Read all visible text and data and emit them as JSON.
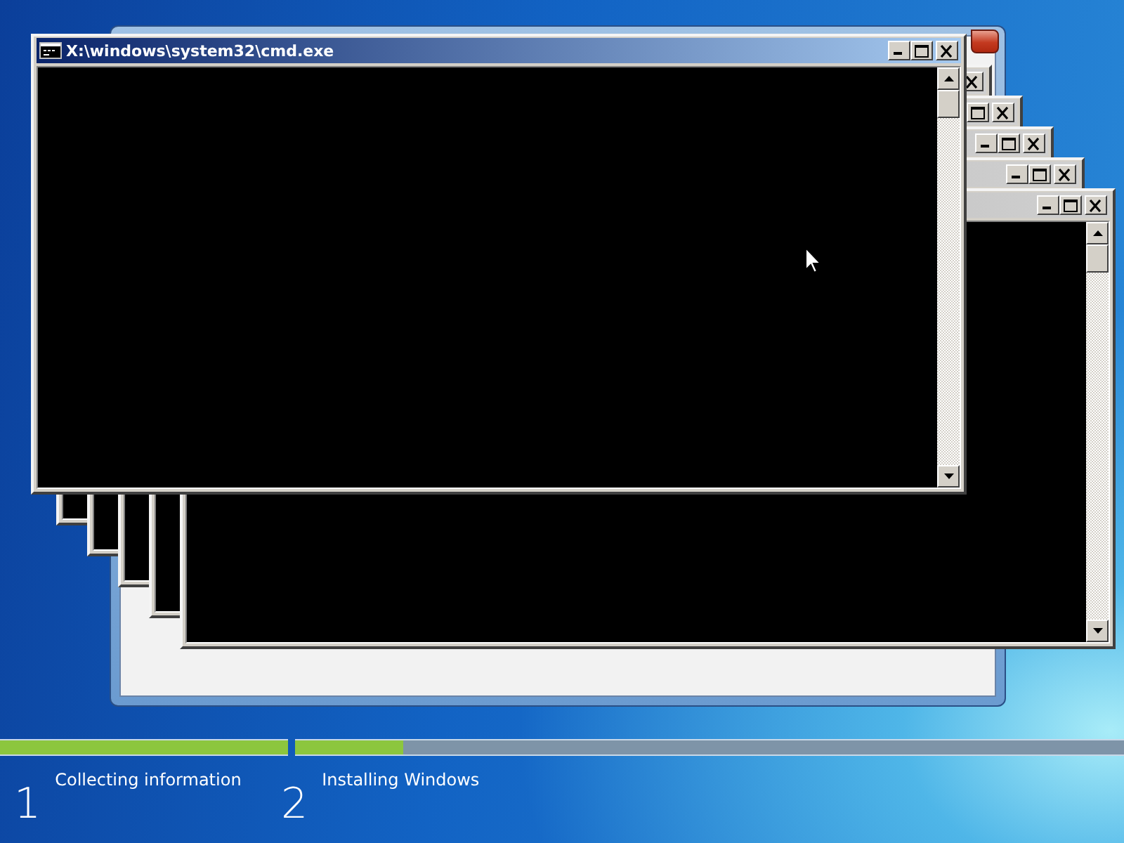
{
  "console_windows": [
    {
      "active": false
    },
    {
      "active": false
    },
    {
      "active": false
    },
    {
      "active": false
    },
    {
      "active": false
    },
    {
      "active": true,
      "title": "X:\\windows\\system32\\cmd.exe"
    }
  ],
  "progress": {
    "steps": [
      {
        "number": "1",
        "label": "Collecting information",
        "level": 1
      },
      {
        "number": "2",
        "label": "Installing Windows",
        "level": 0.13
      }
    ]
  }
}
